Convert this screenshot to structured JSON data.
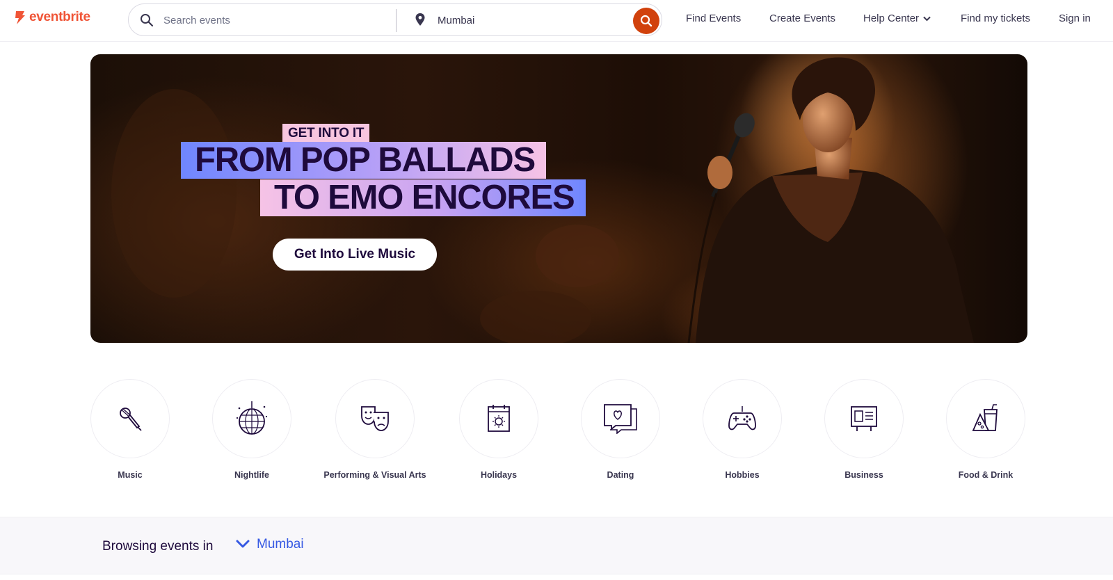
{
  "header": {
    "logo_text": "eventbrite",
    "search": {
      "placeholder": "Search events",
      "location_value": "Mumbai"
    },
    "nav": [
      {
        "label": "Find Events"
      },
      {
        "label": "Create Events"
      },
      {
        "label": "Help Center"
      },
      {
        "label": "Find my tickets"
      },
      {
        "label": "Sign in"
      }
    ]
  },
  "hero": {
    "tag": "GET INTO IT",
    "headline_line1": "FROM POP BALLADS",
    "headline_line2": "TO EMO ENCORES",
    "cta_label": "Get Into Live Music"
  },
  "categories": [
    {
      "label": "Music",
      "icon": "microphone-icon"
    },
    {
      "label": "Nightlife",
      "icon": "disco-ball-icon"
    },
    {
      "label": "Performing & Visual Arts",
      "icon": "theater-masks-icon"
    },
    {
      "label": "Holidays",
      "icon": "calendar-sun-icon"
    },
    {
      "label": "Dating",
      "icon": "chat-heart-icon"
    },
    {
      "label": "Hobbies",
      "icon": "gamepad-icon"
    },
    {
      "label": "Business",
      "icon": "presentation-board-icon"
    },
    {
      "label": "Food & Drink",
      "icon": "food-drink-icon"
    }
  ],
  "browse": {
    "label": "Browsing events in",
    "location": "Mumbai"
  },
  "colors": {
    "brand": "#f05537",
    "search_button": "#d1410c",
    "link": "#3659e3",
    "text_dark": "#1e0a3c"
  }
}
